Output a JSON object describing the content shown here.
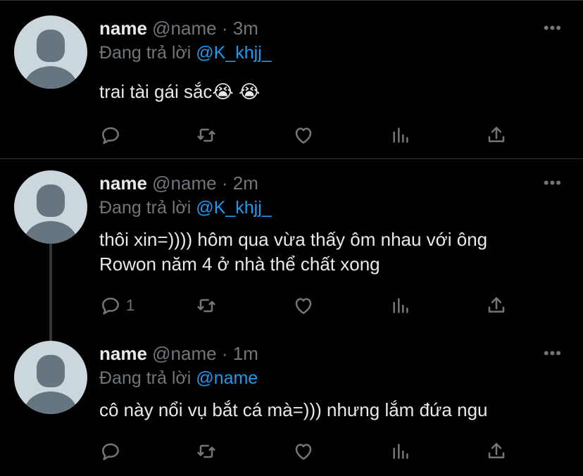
{
  "tweets": [
    {
      "name": "name",
      "handle": "@name",
      "separator": "·",
      "time": "3m",
      "reply_prefix": "Đang trả lời",
      "reply_to": "@K_khjj_",
      "text_lines": [
        "trai tài gái sắc😭 😭"
      ],
      "reply_count": ""
    },
    {
      "name": "name",
      "handle": "@name",
      "separator": "·",
      "time": "2m",
      "reply_prefix": "Đang trả lời",
      "reply_to": "@K_khjj_",
      "text_lines": [
        "thôi xin=)))) hôm qua vừa thấy ôm nhau với ông",
        "Rowon năm 4 ở nhà thể chất xong"
      ],
      "reply_count": "1"
    },
    {
      "name": "name",
      "handle": "@name",
      "separator": "·",
      "time": "1m",
      "reply_prefix": "Đang trả lời",
      "reply_to": "@name",
      "text_lines": [
        "cô này nổi vụ bắt cá mà=))) nhưng lắm đứa ngu"
      ],
      "reply_count": ""
    }
  ],
  "more_glyph": "•••",
  "icons": [
    "reply-icon",
    "retweet-icon",
    "like-icon",
    "analytics-icon",
    "share-icon",
    "more-icon"
  ],
  "colors": {
    "background": "#000000",
    "mention": "#1d9bf0",
    "muted": "#71767b",
    "avatar_bg": "#ccd6dd",
    "avatar_fg": "#66757f"
  }
}
